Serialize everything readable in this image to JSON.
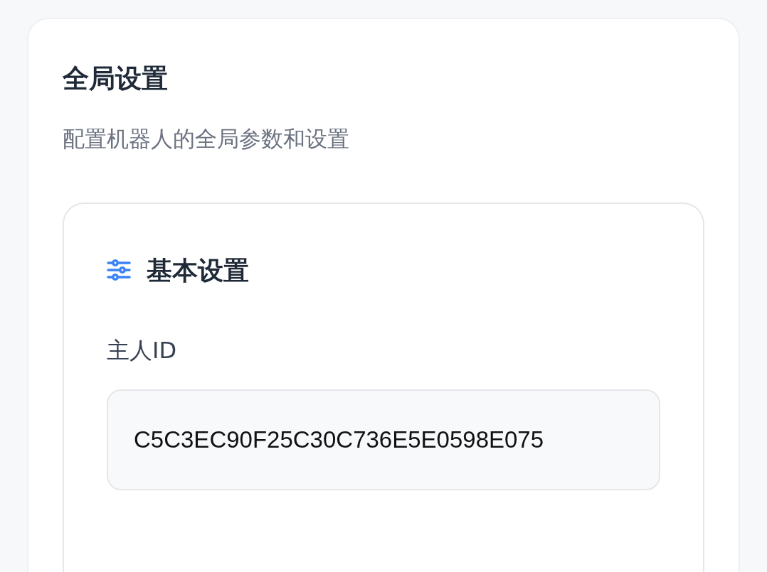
{
  "page": {
    "title": "全局设置",
    "subtitle": "配置机器人的全局参数和设置"
  },
  "section": {
    "title": "基本设置",
    "fields": [
      {
        "label": "主人ID",
        "value": "C5C3EC90F25C30C736E5E0598E075"
      }
    ]
  }
}
